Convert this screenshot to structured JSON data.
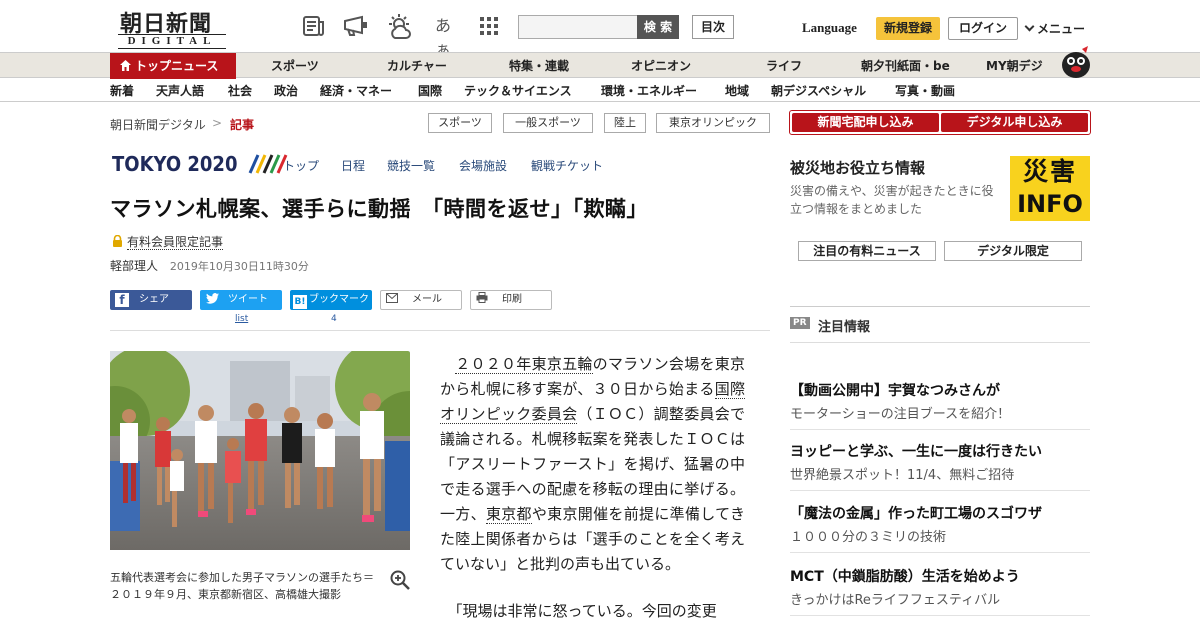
{
  "header": {
    "logo_kanji": "朝日新聞",
    "logo_sub": "DIGITAL",
    "icons": [
      "newspaper-icon",
      "megaphone-icon",
      "weather-icon",
      "font-size-icon",
      "grid-icon"
    ],
    "font_icon_text": "あぁ",
    "search_placeholder": "",
    "search_label": "検 索",
    "toc_label": "目次",
    "language_label": "Language",
    "register_label": "新規登録",
    "login_label": "ログイン",
    "menu_label": "メニュー"
  },
  "nav_primary": {
    "active": "トップニュース",
    "items": [
      "スポーツ",
      "カルチャー",
      "特集・連載",
      "オピニオン",
      "ライフ",
      "朝夕刊紙面・be",
      "MY朝デジ"
    ]
  },
  "nav_secondary": {
    "items": [
      "新着",
      "天声人語",
      "社会",
      "政治",
      "経済・マネー",
      "国際",
      "テック＆サイエンス",
      "環境・エネルギー",
      "地域",
      "朝デジスペシャル",
      "写真・動画"
    ]
  },
  "breadcrumb": {
    "home": "朝日新聞デジタル",
    "sep": ">",
    "current": "記事"
  },
  "tags": [
    "スポーツ",
    "一般スポーツ",
    "陸上",
    "東京オリンピック"
  ],
  "tokyo2020": {
    "logo": "TOKYO 2020",
    "links": [
      "トップ",
      "日程",
      "競技一覧",
      "会場施設",
      "観戦チケット"
    ]
  },
  "article": {
    "headline": "マラソン札幌案、選手らに動揺　「時間を返せ」「欺瞞」",
    "paid_label": "有料会員限定記事",
    "author": "軽部理人",
    "date": "2019年10月30日11時30分",
    "share": {
      "facebook": "シェア",
      "twitter": "ツイート",
      "hatena": "ブックマーク",
      "mail": "メール",
      "print": "印刷",
      "twitter_count": "list",
      "hatena_count": "4"
    },
    "caption": "五輪代表選考会に参加した男子マラソンの選手たち＝２０１９年９月、東京都新宿区、高橋雄大撮影",
    "body": {
      "p1_a": "２０２０年東京五輪",
      "p1_b": "のマラソン会場を東京から札幌に移す案が、３０日から始まる",
      "p1_c": "国際オリンピック委員会",
      "p1_d": "（ＩＯＣ）調整委員会で議論される。札幌移転案を発表したＩＯＣは「アスリートファースト」を掲げ、猛暑の中で走る選手への配慮を移転の理由に挙げる。一方、",
      "p1_e": "東京都",
      "p1_f": "や東京開催を前提に準備してきた陸上関係者からは「選手のことを全く考えていない」と批判の声も出ている。",
      "p2": "「現場は非常に怒っている。今回の変更"
    }
  },
  "sidebar": {
    "subscribe_newspaper": "新聞宅配申し込み",
    "subscribe_digital": "デジタル申し込み",
    "disaster_title": "被災地お役立ち情報",
    "disaster_desc": "災害の備えや、災害が起きたときに役立つ情報をまとめました",
    "disaster_badge_top": "災害",
    "disaster_badge_bottom": "INFO",
    "tab_paid_news": "注目の有料ニュース",
    "tab_digital_only": "デジタル限定",
    "pr_badge": "PR",
    "pr_title": "注目情報",
    "pr_items": [
      {
        "head": "【動画公開中】宇賀なつみさんが",
        "sub": "モーターショーの注目ブースを紹介！"
      },
      {
        "head": "ヨッピーと学ぶ、一生に一度は行きたい",
        "sub": "世界絶景スポット！11/4、無料ご招待"
      },
      {
        "head": "「魔法の金属」作った町工場のスゴワザ",
        "sub": "１０００分の３ミリの技術"
      },
      {
        "head": "MCT（中鎖脂肪酸）生活を始めよう",
        "sub": "きっかけはReライフフェスティバル"
      }
    ]
  },
  "colors": {
    "brand_red": "#b8141a",
    "register_yellow": "#f5c33b",
    "nav_bg": "#e9e6df",
    "tokyo_navy": "#1f2a5a",
    "facebook": "#3b5998",
    "twitter": "#1da1f2",
    "hatena": "#008fde"
  }
}
